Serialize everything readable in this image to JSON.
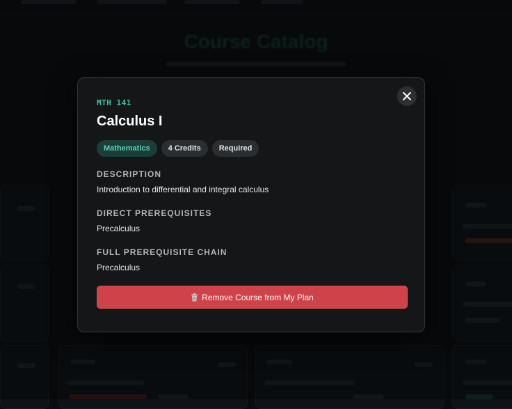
{
  "modal": {
    "course_code": "MTH 141",
    "course_title": "Calculus I",
    "badges": {
      "subject": "Mathematics",
      "credits": "4 Credits",
      "requirement": "Required"
    },
    "sections": {
      "description": {
        "heading": "DESCRIPTION",
        "text": "Introduction to differential and integral calculus"
      },
      "direct_prerequisites": {
        "heading": "DIRECT PREREQUISITES",
        "text": "Precalculus"
      },
      "prerequisite_chain": {
        "heading": "FULL PREREQUISITE CHAIN",
        "text": "Precalculus"
      }
    },
    "remove_button_label": "Remove Course from My Plan",
    "close_icon": "close-icon",
    "remove_icon": "trash-icon"
  },
  "background": {
    "page_title": "Course Catalog"
  },
  "colors": {
    "accent": "#3ec2aa",
    "danger": "#cf4249",
    "modal_bg": "#141618"
  }
}
